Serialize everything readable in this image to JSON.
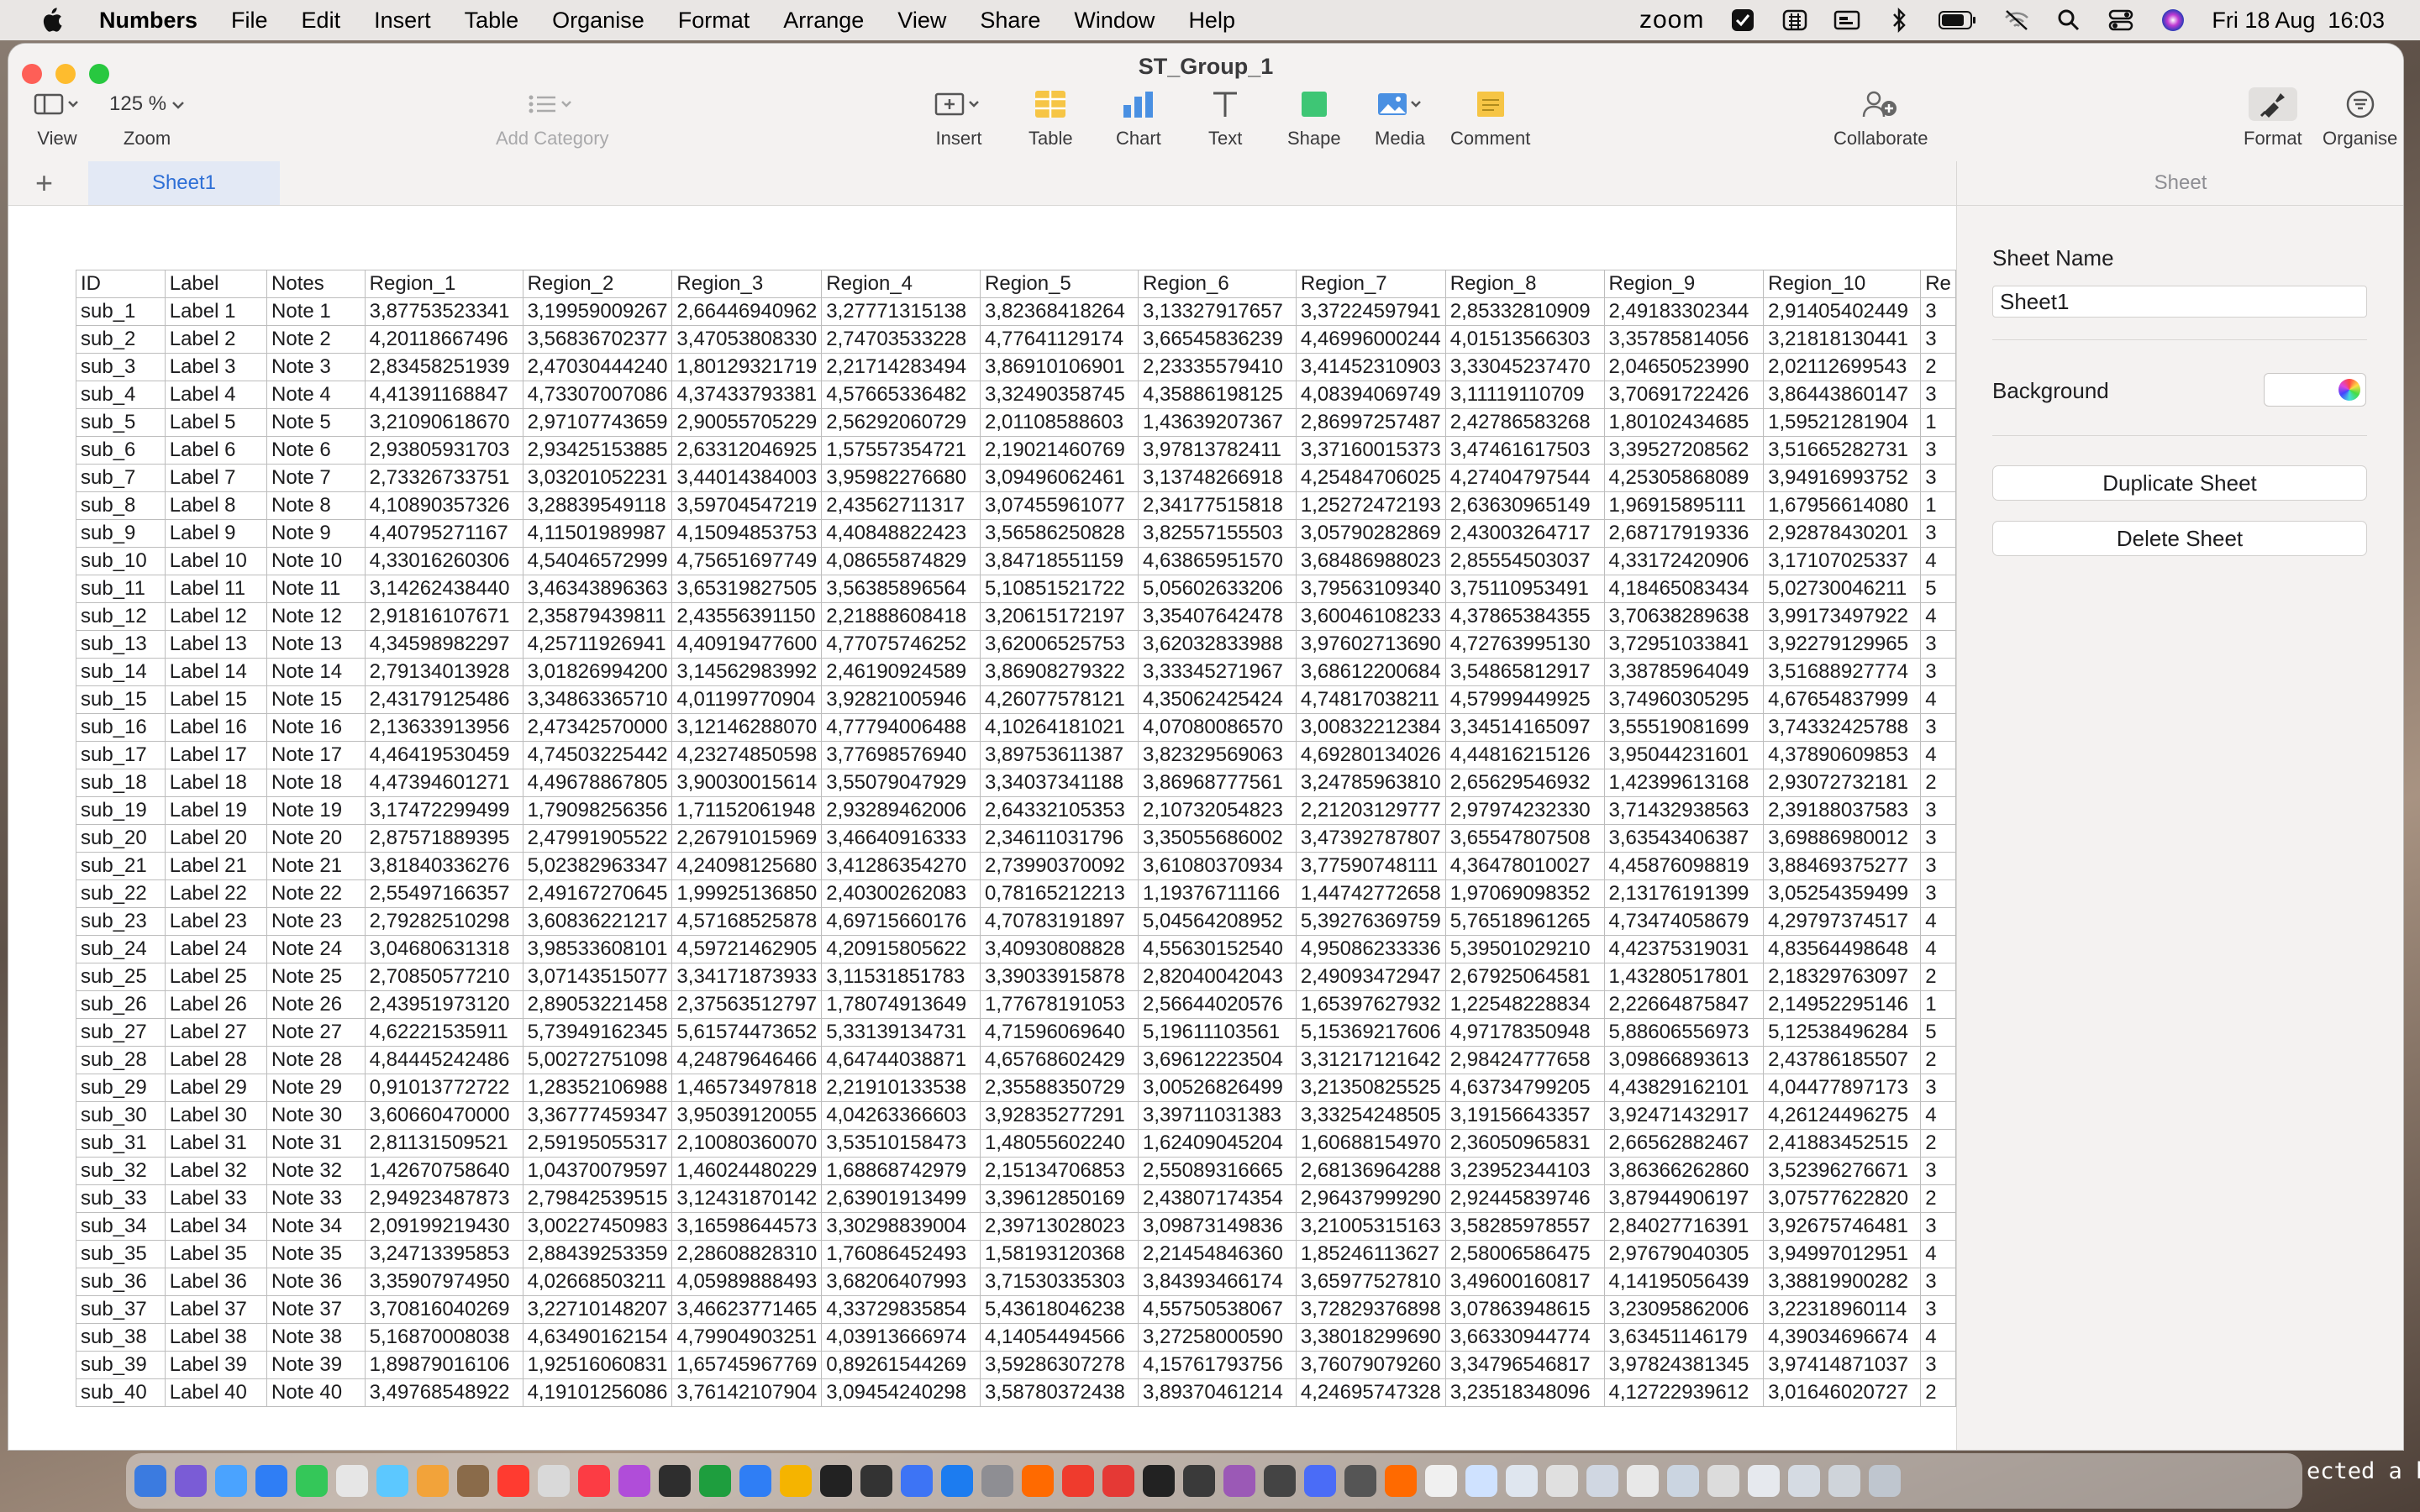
{
  "menubar": {
    "app_name": "Numbers",
    "items": [
      "File",
      "Edit",
      "Insert",
      "Table",
      "Organise",
      "Format",
      "Arrange",
      "View",
      "Share",
      "Window",
      "Help"
    ],
    "zoom_label": "zoom",
    "datetime": "Fri 18 Aug  16:03"
  },
  "window": {
    "title": "ST_Group_1"
  },
  "toolbar": {
    "view_label": "View",
    "zoom_value": "125 %",
    "zoom_label": "Zoom",
    "add_category_label": "Add Category",
    "insert_label": "Insert",
    "table_label": "Table",
    "chart_label": "Chart",
    "text_label": "Text",
    "shape_label": "Shape",
    "media_label": "Media",
    "comment_label": "Comment",
    "collaborate_label": "Collaborate",
    "format_label": "Format",
    "organise_label": "Organise"
  },
  "tabs": {
    "add": "+",
    "sheet": "Sheet1"
  },
  "table": {
    "headers": [
      "ID",
      "Label",
      "Notes",
      "Region_1",
      "Region_2",
      "Region_3",
      "Region_4",
      "Region_5",
      "Region_6",
      "Region_7",
      "Region_8",
      "Region_9",
      "Region_10",
      "Re"
    ],
    "rows": [
      [
        "sub_1",
        "Label 1",
        "Note 1",
        "3,87753523341",
        "3,19959009267",
        "2,66446940962",
        "3,27771315138",
        "3,82368418264",
        "3,13327917657",
        "3,37224597941",
        "2,85332810909",
        "2,49183302344",
        "2,91405402449",
        "3"
      ],
      [
        "sub_2",
        "Label 2",
        "Note 2",
        "4,20118667496",
        "3,56836702377",
        "3,47053808330",
        "2,74703533228",
        "4,77641129174",
        "3,66545836239",
        "4,46996000244",
        "4,01513566303",
        "3,35785814056",
        "3,21818130441",
        "3"
      ],
      [
        "sub_3",
        "Label 3",
        "Note 3",
        "2,83458251939",
        "2,47030444240",
        "1,80129321719",
        "2,21714283494",
        "3,86910106901",
        "2,23335579410",
        "3,41452310903",
        "3,33045237470",
        "2,04650523990",
        "2,02112699543",
        "2"
      ],
      [
        "sub_4",
        "Label 4",
        "Note 4",
        "4,41391168847",
        "4,73307007086",
        "4,37433793381",
        "4,57665336482",
        "3,32490358745",
        "4,35886198125",
        "4,08394069749",
        "3,11119110709",
        "3,70691722426",
        "3,86443860147",
        "3"
      ],
      [
        "sub_5",
        "Label 5",
        "Note 5",
        "3,21090618670",
        "2,97107743659",
        "2,90055705229",
        "2,56292060729",
        "2,01108588603",
        "1,43639207367",
        "2,86997257487",
        "2,42786583268",
        "1,80102434685",
        "1,59521281904",
        "1"
      ],
      [
        "sub_6",
        "Label 6",
        "Note 6",
        "2,93805931703",
        "2,93425153885",
        "2,63312046925",
        "1,57557354721",
        "2,19021460769",
        "3,97813782411",
        "3,37160015373",
        "3,47461617503",
        "3,39527208562",
        "3,51665282731",
        "3"
      ],
      [
        "sub_7",
        "Label 7",
        "Note 7",
        "2,73326733751",
        "3,03201052231",
        "3,44014384003",
        "3,95982276680",
        "3,09496062461",
        "3,13748266918",
        "4,25484706025",
        "4,27404797544",
        "4,25305868089",
        "3,94916993752",
        "3"
      ],
      [
        "sub_8",
        "Label 8",
        "Note 8",
        "4,10890357326",
        "3,28839549118",
        "3,59704547219",
        "2,43562711317",
        "3,07455961077",
        "2,34177515818",
        "1,25272472193",
        "2,63630965149",
        "1,96915895111",
        "1,67956614080",
        "1"
      ],
      [
        "sub_9",
        "Label 9",
        "Note 9",
        "4,40795271167",
        "4,11501989987",
        "4,15094853753",
        "4,40848822423",
        "3,56586250828",
        "3,82557155503",
        "3,05790282869",
        "2,43003264717",
        "2,68717919336",
        "2,92878430201",
        "3"
      ],
      [
        "sub_10",
        "Label 10",
        "Note 10",
        "4,33016260306",
        "4,54046572999",
        "4,75651697749",
        "4,08655874829",
        "3,84718551159",
        "4,63865951570",
        "3,68486988023",
        "2,85554503037",
        "4,33172420906",
        "3,17107025337",
        "4"
      ],
      [
        "sub_11",
        "Label 11",
        "Note 11",
        "3,14262438440",
        "3,46343896363",
        "3,65319827505",
        "3,56385896564",
        "5,10851521722",
        "5,05602633206",
        "3,79563109340",
        "3,75110953491",
        "4,18465083434",
        "5,02730046211",
        "5"
      ],
      [
        "sub_12",
        "Label 12",
        "Note 12",
        "2,91816107671",
        "2,35879439811",
        "2,43556391150",
        "2,21888608418",
        "3,20615172197",
        "3,35407642478",
        "3,60046108233",
        "4,37865384355",
        "3,70638289638",
        "3,99173497922",
        "4"
      ],
      [
        "sub_13",
        "Label 13",
        "Note 13",
        "4,34598982297",
        "4,25711926941",
        "4,40919477600",
        "4,77075746252",
        "3,62006525753",
        "3,62032833988",
        "3,97602713690",
        "4,72763995130",
        "3,72951033841",
        "3,92279129965",
        "3"
      ],
      [
        "sub_14",
        "Label 14",
        "Note 14",
        "2,79134013928",
        "3,01826994200",
        "3,14562983992",
        "2,46190924589",
        "3,86908279322",
        "3,33345271967",
        "3,68612200684",
        "3,54865812917",
        "3,38785964049",
        "3,51688927774",
        "3"
      ],
      [
        "sub_15",
        "Label 15",
        "Note 15",
        "2,43179125486",
        "3,34863365710",
        "4,01199770904",
        "3,92821005946",
        "4,26077578121",
        "4,35062425424",
        "4,74817038211",
        "4,57999449925",
        "3,74960305295",
        "4,67654837999",
        "4"
      ],
      [
        "sub_16",
        "Label 16",
        "Note 16",
        "2,13633913956",
        "2,47342570000",
        "3,12146288070",
        "4,77794006488",
        "4,10264181021",
        "4,07080086570",
        "3,00832212384",
        "3,34514165097",
        "3,55519081699",
        "3,74332425788",
        "3"
      ],
      [
        "sub_17",
        "Label 17",
        "Note 17",
        "4,46419530459",
        "4,74503225442",
        "4,23274850598",
        "3,77698576940",
        "3,89753611387",
        "3,82329569063",
        "4,69280134026",
        "4,44816215126",
        "3,95044231601",
        "4,37890609853",
        "4"
      ],
      [
        "sub_18",
        "Label 18",
        "Note 18",
        "4,47394601271",
        "4,49678867805",
        "3,90030015614",
        "3,55079047929",
        "3,34037341188",
        "3,86968777561",
        "3,24785963810",
        "2,65629546932",
        "1,42399613168",
        "2,93072732181",
        "2"
      ],
      [
        "sub_19",
        "Label 19",
        "Note 19",
        "3,17472299499",
        "1,79098256356",
        "1,71152061948",
        "2,93289462006",
        "2,64332105353",
        "2,10732054823",
        "2,21203129777",
        "2,97974232330",
        "3,71432938563",
        "2,39188037583",
        "3"
      ],
      [
        "sub_20",
        "Label 20",
        "Note 20",
        "2,87571889395",
        "2,47991905522",
        "2,26791015969",
        "3,46640916333",
        "2,34611031796",
        "3,35055686002",
        "3,47392787807",
        "3,65547807508",
        "3,63543406387",
        "3,69886980012",
        "3"
      ],
      [
        "sub_21",
        "Label 21",
        "Note 21",
        "3,81840336276",
        "5,02382963347",
        "4,24098125680",
        "3,41286354270",
        "2,73990370092",
        "3,61080370934",
        "3,77590748111",
        "4,36478010027",
        "4,45876098819",
        "3,88469375277",
        "3"
      ],
      [
        "sub_22",
        "Label 22",
        "Note 22",
        "2,55497166357",
        "2,49167270645",
        "1,99925136850",
        "2,40300262083",
        "0,78165212213",
        "1,19376711166",
        "1,44742772658",
        "1,97069098352",
        "2,13176191399",
        "3,05254359499",
        "3"
      ],
      [
        "sub_23",
        "Label 23",
        "Note 23",
        "2,79282510298",
        "3,60836221217",
        "4,57168525878",
        "4,69715660176",
        "4,70783191897",
        "5,04564208952",
        "5,39276369759",
        "5,76518961265",
        "4,73474058679",
        "4,29797374517",
        "4"
      ],
      [
        "sub_24",
        "Label 24",
        "Note 24",
        "3,04680631318",
        "3,98533608101",
        "4,59721462905",
        "4,20915805622",
        "3,40930808828",
        "4,55630152540",
        "4,95086233336",
        "5,39501029210",
        "4,42375319031",
        "4,83564498648",
        "4"
      ],
      [
        "sub_25",
        "Label 25",
        "Note 25",
        "2,70850577210",
        "3,07143515077",
        "3,34171873933",
        "3,11531851783",
        "3,39033915878",
        "2,82040042043",
        "2,49093472947",
        "2,67925064581",
        "1,43280517801",
        "2,18329763097",
        "2"
      ],
      [
        "sub_26",
        "Label 26",
        "Note 26",
        "2,43951973120",
        "2,89053221458",
        "2,37563512797",
        "1,78074913649",
        "1,77678191053",
        "2,56644020576",
        "1,65397627932",
        "1,22548228834",
        "2,22664875847",
        "2,14952295146",
        "1"
      ],
      [
        "sub_27",
        "Label 27",
        "Note 27",
        "4,62221535911",
        "5,73949162345",
        "5,61574473652",
        "5,33139134731",
        "4,71596069640",
        "5,19611103561",
        "5,15369217606",
        "4,97178350948",
        "5,88606556973",
        "5,12538496284",
        "5"
      ],
      [
        "sub_28",
        "Label 28",
        "Note 28",
        "4,84445242486",
        "5,00272751098",
        "4,24879646466",
        "4,64744038871",
        "4,65768602429",
        "3,69612223504",
        "3,31217121642",
        "2,98424777658",
        "3,09866893613",
        "2,43786185507",
        "2"
      ],
      [
        "sub_29",
        "Label 29",
        "Note 29",
        "0,91013772722",
        "1,28352106988",
        "1,46573497818",
        "2,21910133538",
        "2,35588350729",
        "3,00526826499",
        "3,21350825525",
        "4,63734799205",
        "4,43829162101",
        "4,04477897173",
        "3"
      ],
      [
        "sub_30",
        "Label 30",
        "Note 30",
        "3,60660470000",
        "3,36777459347",
        "3,95039120055",
        "4,04263366603",
        "3,92835277291",
        "3,39711031383",
        "3,33254248505",
        "3,19156643357",
        "3,92471432917",
        "4,26124496275",
        "4"
      ],
      [
        "sub_31",
        "Label 31",
        "Note 31",
        "2,81131509521",
        "2,59195055317",
        "2,10080360070",
        "3,53510158473",
        "1,48055602240",
        "1,62409045204",
        "1,60688154970",
        "2,36050965831",
        "2,66562882467",
        "2,41883452515",
        "2"
      ],
      [
        "sub_32",
        "Label 32",
        "Note 32",
        "1,42670758640",
        "1,04370079597",
        "1,46024480229",
        "1,68868742979",
        "2,15134706853",
        "2,55089316665",
        "2,68136964288",
        "3,23952344103",
        "3,86366262860",
        "3,52396276671",
        "3"
      ],
      [
        "sub_33",
        "Label 33",
        "Note 33",
        "2,94923487873",
        "2,79842539515",
        "3,12431870142",
        "2,63901913499",
        "3,39612850169",
        "2,43807174354",
        "2,96437999290",
        "2,92445839746",
        "3,87944906197",
        "3,07577622820",
        "2"
      ],
      [
        "sub_34",
        "Label 34",
        "Note 34",
        "2,09199219430",
        "3,00227450983",
        "3,16598644573",
        "3,30298839004",
        "2,39713028023",
        "3,09873149836",
        "3,21005315163",
        "3,58285978557",
        "2,84027716391",
        "3,92675746481",
        "3"
      ],
      [
        "sub_35",
        "Label 35",
        "Note 35",
        "3,24713395853",
        "2,88439253359",
        "2,28608828310",
        "1,76086452493",
        "1,58193120368",
        "2,21454846360",
        "1,85246113627",
        "2,58006586475",
        "2,97679040305",
        "3,94997012951",
        "4"
      ],
      [
        "sub_36",
        "Label 36",
        "Note 36",
        "3,35907974950",
        "4,02668503211",
        "4,05989888493",
        "3,68206407993",
        "3,71530335303",
        "3,84393466174",
        "3,65977527810",
        "3,49600160817",
        "4,14195056439",
        "3,38819900282",
        "3"
      ],
      [
        "sub_37",
        "Label 37",
        "Note 37",
        "3,70816040269",
        "3,22710148207",
        "3,46623771465",
        "4,33729835854",
        "5,43618046238",
        "4,55750538067",
        "3,72829376898",
        "3,07863948615",
        "3,23095862006",
        "3,22318960114",
        "3"
      ],
      [
        "sub_38",
        "Label 38",
        "Note 38",
        "5,16870008038",
        "4,63490162154",
        "4,79904903251",
        "4,03913666974",
        "4,14054494566",
        "3,27258000590",
        "3,38018299690",
        "3,66330944774",
        "3,63451146179",
        "4,39034696674",
        "4"
      ],
      [
        "sub_39",
        "Label 39",
        "Note 39",
        "1,89879016106",
        "1,92516060831",
        "1,65745967769",
        "0,89261544269",
        "3,59286307278",
        "4,15761793756",
        "3,76079079260",
        "3,34796546817",
        "3,97824381345",
        "3,97414871037",
        "3"
      ],
      [
        "sub_40",
        "Label 40",
        "Note 40",
        "3,49768548922",
        "4,19101256086",
        "3,76142107904",
        "3,09454240298",
        "3,58780372438",
        "3,89370461214",
        "4,24695747328",
        "3,23518348096",
        "4,12722939612",
        "3,01646020727",
        "2"
      ]
    ]
  },
  "inspector": {
    "tab_label": "Sheet",
    "sheet_name_label": "Sheet Name",
    "sheet_name_value": "Sheet1",
    "background_label": "Background",
    "duplicate_label": "Duplicate Sheet",
    "delete_label": "Delete Sheet"
  },
  "dock": {
    "terminal_fragment": "ected a br"
  }
}
